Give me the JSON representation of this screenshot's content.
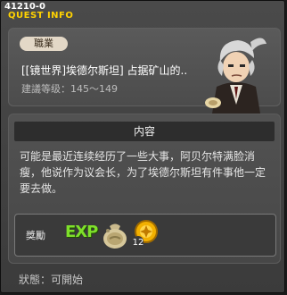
{
  "window": {
    "quest_id": "41210-0",
    "title": "QUEST INFO"
  },
  "quest": {
    "job_tag": "職業",
    "name": "[[镜世界]埃德尔斯坦] 占据矿山的..",
    "level_req": "建議等级：145～149",
    "npc_icon": "old-man-npc-portrait"
  },
  "content": {
    "section_title": "内容",
    "description": "可能是最近连续经历了一些大事，阿贝尔特满脸消瘦，他说作为议会长，为了埃德尔斯坦有件事他一定要去做。"
  },
  "rewards": {
    "label": "獎勵",
    "exp_label": "EXP",
    "items": [
      {
        "icon": "money-bag-icon"
      },
      {
        "icon": "coin-icon",
        "count": "12"
      }
    ]
  },
  "status": {
    "text": "狀態：可開始"
  },
  "colors": {
    "title": "#ffd200",
    "exp": "#7ee02a",
    "tag_bg": "#e3d8c7"
  }
}
